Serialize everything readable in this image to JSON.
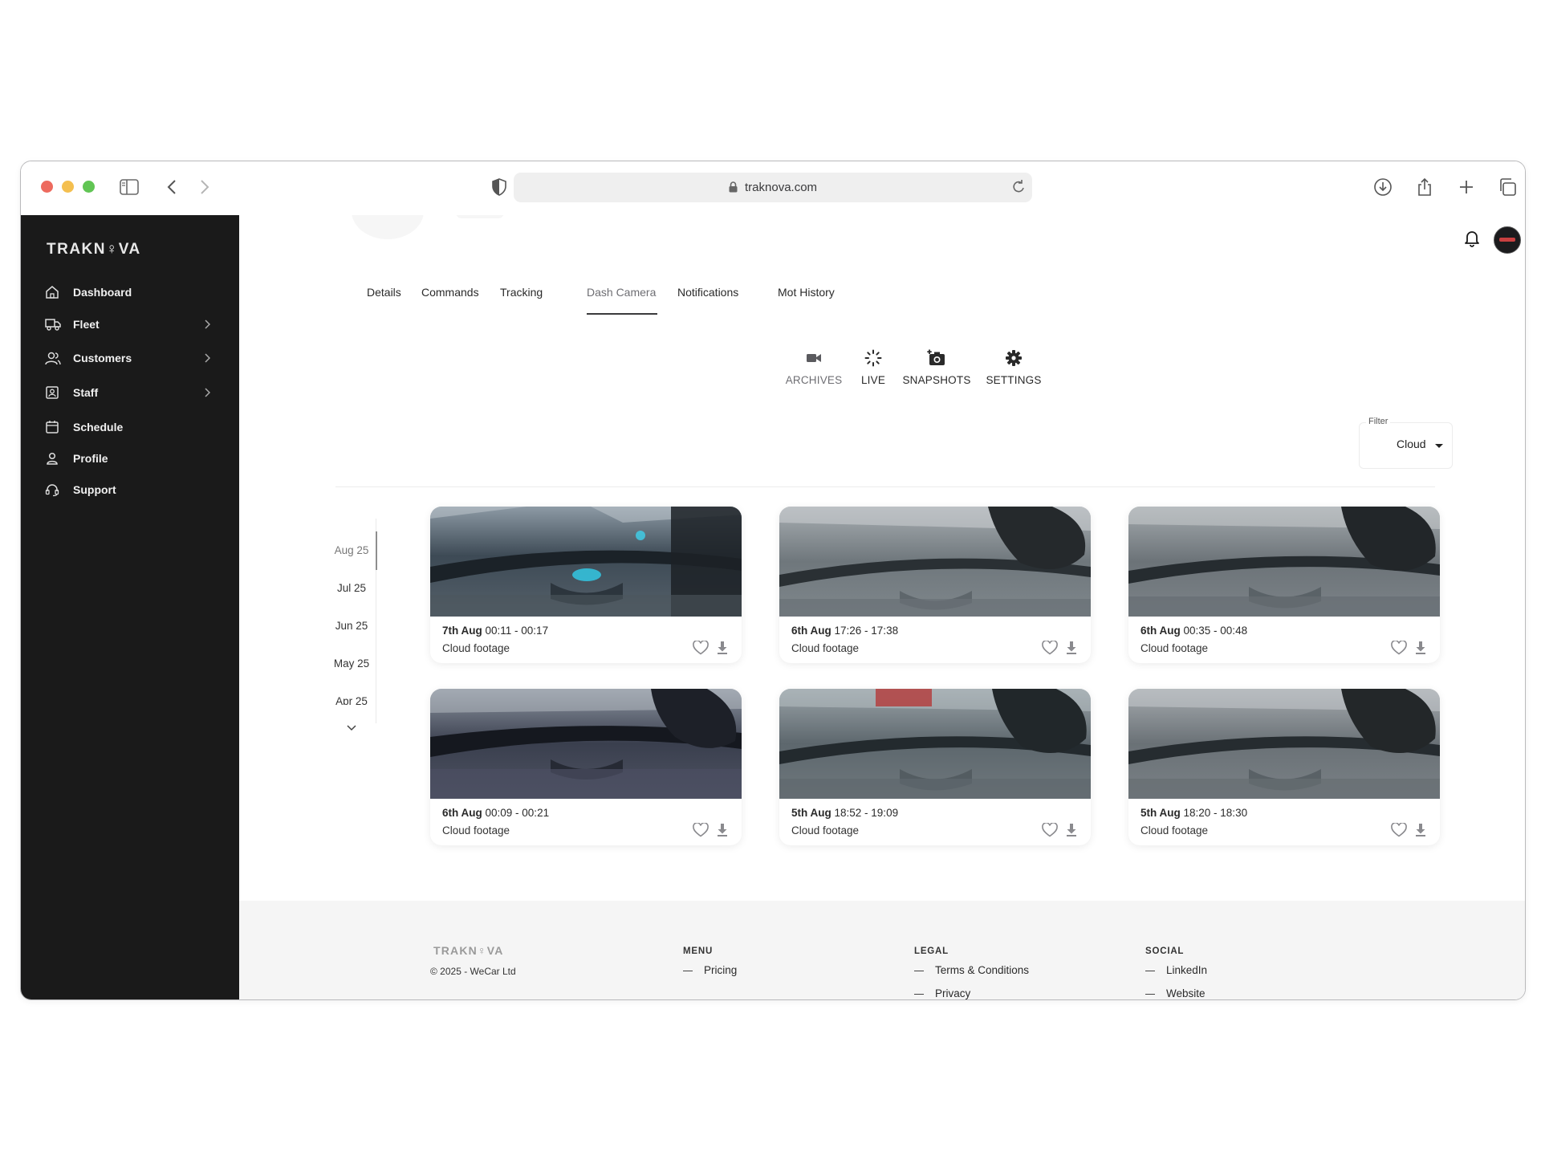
{
  "browser": {
    "url": "traknova.com"
  },
  "sidebar": {
    "brand": "TRAKN♀VA",
    "items": [
      {
        "label": "Dashboard",
        "icon": "home-icon",
        "expandable": false
      },
      {
        "label": "Fleet",
        "icon": "truck-icon",
        "expandable": true
      },
      {
        "label": "Customers",
        "icon": "users-icon",
        "expandable": true
      },
      {
        "label": "Staff",
        "icon": "badge-icon",
        "expandable": true
      },
      {
        "label": "Schedule",
        "icon": "calendar-icon",
        "expandable": false
      },
      {
        "label": "Profile",
        "icon": "user-icon",
        "expandable": false
      },
      {
        "label": "Support",
        "icon": "support-icon",
        "expandable": false
      }
    ]
  },
  "tabs": [
    "Details",
    "Commands",
    "Tracking",
    "Dash Camera",
    "Notifications",
    "Mot History"
  ],
  "active_tab": "Dash Camera",
  "camera_tabs": [
    "ARCHIVES",
    "LIVE",
    "SNAPSHOTS",
    "SETTINGS"
  ],
  "active_camera_tab": "ARCHIVES",
  "filter": {
    "label": "Filter",
    "value": "Cloud"
  },
  "timeline": [
    "Aug 25",
    "Jul 25",
    "Jun 25",
    "May 25",
    "Apr 25"
  ],
  "active_month": "Aug 25",
  "clips": [
    {
      "day": "7th Aug",
      "time": "00:11 - 00:17",
      "source": "Cloud footage"
    },
    {
      "day": "6th Aug",
      "time": "17:26 - 17:38",
      "source": "Cloud footage"
    },
    {
      "day": "6th Aug",
      "time": "00:35 - 00:48",
      "source": "Cloud footage"
    },
    {
      "day": "6th Aug",
      "time": "00:09 - 00:21",
      "source": "Cloud footage"
    },
    {
      "day": "5th Aug",
      "time": "18:52 - 19:09",
      "source": "Cloud footage"
    },
    {
      "day": "5th Aug",
      "time": "18:20 - 18:30",
      "source": "Cloud footage"
    }
  ],
  "footer": {
    "brand": "TRAKN♀VA",
    "copyright": "© 2025 - WeCar Ltd",
    "menu": {
      "heading": "MENU",
      "links": [
        "Pricing"
      ]
    },
    "legal": {
      "heading": "LEGAL",
      "links": [
        "Terms & Conditions",
        "Privacy"
      ]
    },
    "social": {
      "heading": "SOCIAL",
      "links": [
        "LinkedIn",
        "Website"
      ]
    }
  },
  "colors": {
    "sidebar_bg": "#1a1a1a",
    "footer_bg": "#f5f5f5",
    "accent": "#3a3a3c"
  }
}
